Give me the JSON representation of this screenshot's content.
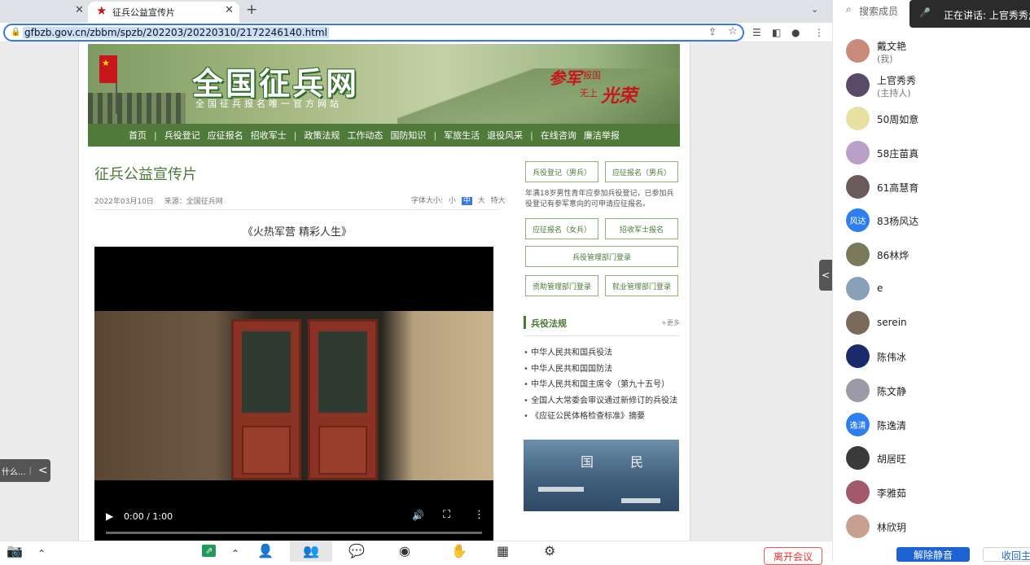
{
  "browser": {
    "tabs": [
      {
        "title": ""
      },
      {
        "title": "征兵公益宣传片"
      }
    ],
    "url": "gfbzb.gov.cn/zbbm/spzb/202203/20220310/2172246140.html"
  },
  "site": {
    "logo_title": "全国征兵网",
    "logo_subtitle": "全国征兵报名唯一官方网站",
    "slogan": {
      "big1": "参军",
      "small1": "报国",
      "small2": "无上",
      "big2": "光荣"
    },
    "nav": [
      "首页",
      "|",
      "兵役登记",
      "应征报名",
      "招收军士",
      "|",
      "政策法规",
      "工作动态",
      "国防知识",
      "|",
      "军旅生活",
      "退役风采",
      "|",
      "在线咨询",
      "廉洁举报"
    ],
    "colors": {
      "nav_bg": "#4f7a3a",
      "accent": "#4a7a36",
      "flag": "#c8161d"
    }
  },
  "article": {
    "title": "征兵公益宣传片",
    "date": "2022年03月10日",
    "source": "来源：全国征兵网",
    "font_label": "字体大小:",
    "font_small": "小",
    "font_mid": "中",
    "font_large": "大",
    "font_xlarge": "特大",
    "subtitle": "《火热军营 精彩人生》"
  },
  "video": {
    "time": "0:00 / 1:00",
    "progress": 0
  },
  "sidebar": {
    "btn_male_register": "兵役登记（男兵）",
    "btn_male_apply": "应征报名（男兵）",
    "desc": "年满18岁男性青年应参加兵役登记，已参加兵役登记有参军意向的可申请应征报名。",
    "btn_female_apply": "应征报名（女兵）",
    "btn_sergeant": "招收军士报名",
    "btn_admin_login": "兵役管理部门登录",
    "btn_aid_login": "资助管理部门登录",
    "btn_employ_login": "就业管理部门登录",
    "laws_title": "兵役法规",
    "laws_more": "+更多",
    "laws": [
      "中华人民共和国兵役法",
      "中华人民共和国国防法",
      "中华人民共和国主席令（第九十五号）",
      "全国人大常委会审议通过新修订的兵役法",
      "《应征公民体格检查标准》摘要"
    ],
    "image_text": "国 民"
  },
  "floating": {
    "left_text": "什么...",
    "left_arrow": "<",
    "right_arrow": "<"
  },
  "meeting": {
    "leave_label": "离开会议",
    "search_placeholder": "搜索成员",
    "speaking": "正在讲话: 上官秀秀;",
    "unmute_label": "解除静音",
    "collapse_label": "收回主持人",
    "participants": [
      {
        "name": "戴文艳",
        "role": "(我)",
        "avatar_color": "#c98a7a",
        "avatar_text": ""
      },
      {
        "name": "上官秀秀",
        "role": "(主持人)",
        "avatar_color": "#5a4a6a",
        "avatar_text": ""
      },
      {
        "name": "50周如意",
        "role": "",
        "avatar_color": "#e8e0a0",
        "avatar_text": ""
      },
      {
        "name": "58庄苗真",
        "role": "",
        "avatar_color": "#b9a0c9",
        "avatar_text": ""
      },
      {
        "name": "61高慧育",
        "role": "",
        "avatar_color": "#6a5a5a",
        "avatar_text": ""
      },
      {
        "name": "83杨风达",
        "role": "",
        "avatar_color": "#2f7ef0",
        "avatar_text": "风达"
      },
      {
        "name": "86林烨",
        "role": "",
        "avatar_color": "#7a7a5a",
        "avatar_text": ""
      },
      {
        "name": "e",
        "role": "",
        "avatar_color": "#8aa0b8",
        "avatar_text": ""
      },
      {
        "name": "serein",
        "role": "",
        "avatar_color": "#7a6a5a",
        "avatar_text": ""
      },
      {
        "name": "陈伟冰",
        "role": "",
        "avatar_color": "#1a2a6a",
        "avatar_text": ""
      },
      {
        "name": "陈文静",
        "role": "",
        "avatar_color": "#9a9aa8",
        "avatar_text": ""
      },
      {
        "name": "陈逸清",
        "role": "",
        "avatar_color": "#2f7ef0",
        "avatar_text": "逸清"
      },
      {
        "name": "胡居旺",
        "role": "",
        "avatar_color": "#3a3a3a",
        "avatar_text": ""
      },
      {
        "name": "李雅茹",
        "role": "",
        "avatar_color": "#a05a6a",
        "avatar_text": ""
      },
      {
        "name": "林欣玥",
        "role": "",
        "avatar_color": "#c9a090",
        "avatar_text": ""
      }
    ]
  }
}
